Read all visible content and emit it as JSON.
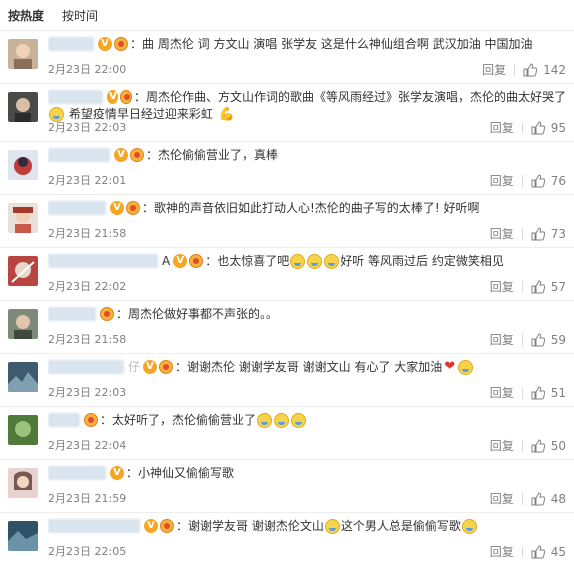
{
  "tabs": {
    "hot": "按热度",
    "time": "按时间"
  },
  "actions": {
    "reply_label": "回复"
  },
  "colors": {
    "accent": "#eb7350",
    "meta": "#808080",
    "divider": "#eeeeee"
  },
  "comments": [
    {
      "text": "：曲 周杰伦 词 方文山 演唱 张学友 这是什么神仙组合啊 武汉加油 中国加油",
      "time": "2月23日 22:00",
      "likes": "142"
    },
    {
      "text": "：周杰伦作曲、方文山作词的歌曲《等风雨经过》张学友演唱，杰伦的曲太好哭了",
      "text2": "希望疫情早日经过迎来彩虹",
      "time": "2月23日 22:03",
      "likes": "95"
    },
    {
      "text": "：杰伦偷偷营业了，真棒",
      "time": "2月23日 22:01",
      "likes": "76"
    },
    {
      "text": "：歌神的声音依旧如此打动人心!杰伦的曲子写的太棒了! 好听啊",
      "time": "2月23日 21:58",
      "likes": "73"
    },
    {
      "text_prefix": "：也太惊喜了吧",
      "text": "好听 等风雨过后 约定微笑相见",
      "name_suffix": "A",
      "time": "2月23日 22:02",
      "likes": "57"
    },
    {
      "text": "：周杰伦做好事都不声张的。。",
      "time": "2月23日 21:58",
      "likes": "59"
    },
    {
      "text": "：谢谢杰伦  谢谢学友哥  谢谢文山  有心了  大家加油",
      "name_suffix": "仔",
      "time": "2月23日 22:03",
      "likes": "51"
    },
    {
      "text": "：太好听了，杰伦偷偷营业了",
      "time": "2月23日 22:04",
      "likes": "50"
    },
    {
      "text": "：小神仙又偷偷写歌",
      "time": "2月23日 21:59",
      "likes": "48"
    },
    {
      "text": "：谢谢学友哥  谢谢杰伦文山",
      "text_suffix": "这个男人总是偷偷写歌",
      "time": "2月23日 22:05",
      "likes": "45"
    }
  ]
}
